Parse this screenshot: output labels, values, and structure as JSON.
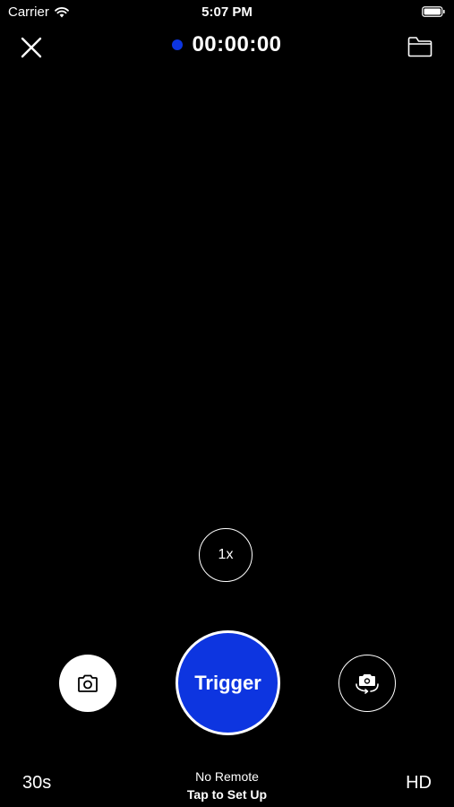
{
  "status_bar": {
    "carrier": "Carrier",
    "time": "5:07 PM"
  },
  "header": {
    "timer": "00:00:00",
    "record_indicator_color": "#0d35e0",
    "close_icon": "close-icon",
    "folder_icon": "folder-icon"
  },
  "camera": {
    "zoom_label": "1x",
    "trigger_label": "Trigger",
    "trigger_color": "#0d35e0",
    "photo_icon": "camera-icon",
    "flip_icon": "flip-camera-icon"
  },
  "footer": {
    "duration": "30s",
    "remote_status": "No Remote",
    "remote_action": "Tap to Set Up",
    "quality": "HD"
  }
}
